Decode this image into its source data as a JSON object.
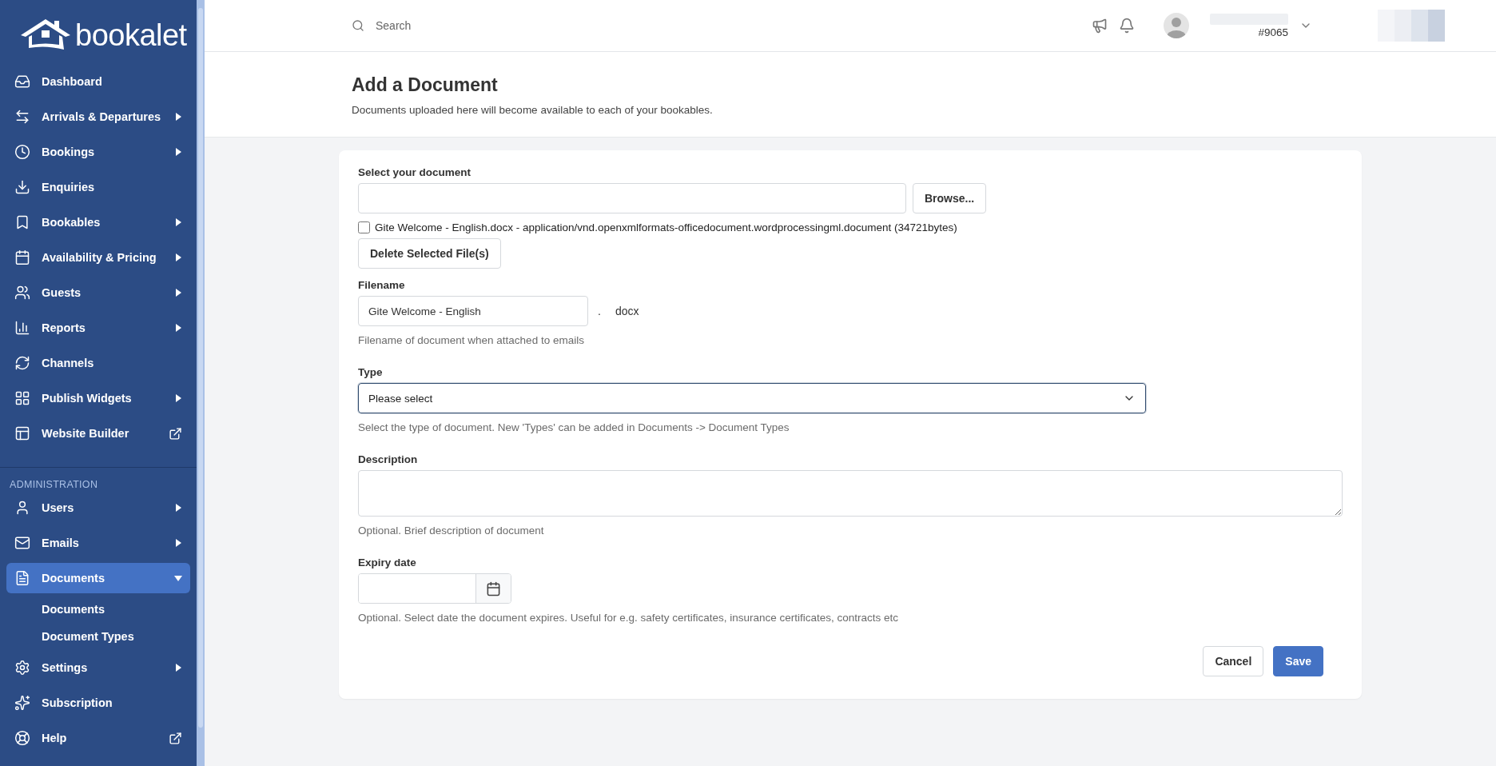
{
  "sidebar": {
    "logo": "bookalet",
    "items": [
      {
        "label": "Dashboard",
        "kind": "link",
        "selected": false
      },
      {
        "label": "Arrivals & Departures",
        "kind": "submenu",
        "expanded": false,
        "selected": false
      },
      {
        "label": "Bookings",
        "kind": "submenu",
        "expanded": false,
        "selected": false
      },
      {
        "label": "Enquiries",
        "kind": "link",
        "selected": false
      },
      {
        "label": "Bookables",
        "kind": "submenu",
        "expanded": false,
        "selected": false
      },
      {
        "label": "Availability & Pricing",
        "kind": "submenu",
        "expanded": false,
        "selected": false
      },
      {
        "label": "Guests",
        "kind": "submenu",
        "expanded": false,
        "selected": false
      },
      {
        "label": "Reports",
        "kind": "submenu",
        "expanded": false,
        "selected": false
      },
      {
        "label": "Channels",
        "kind": "link",
        "selected": false
      },
      {
        "label": "Publish Widgets",
        "kind": "submenu",
        "expanded": false,
        "selected": false
      },
      {
        "label": "Website Builder",
        "kind": "external",
        "selected": false
      }
    ],
    "section_heading": "ADMINISTRATION",
    "admin_items": [
      {
        "label": "Users",
        "kind": "submenu",
        "expanded": false,
        "selected": false
      },
      {
        "label": "Emails",
        "kind": "submenu",
        "expanded": false,
        "selected": false
      },
      {
        "label": "Documents",
        "kind": "submenu",
        "expanded": true,
        "selected": true,
        "children": [
          {
            "label": "Documents"
          },
          {
            "label": "Document Types"
          }
        ]
      },
      {
        "label": "Settings",
        "kind": "submenu",
        "expanded": false,
        "selected": false
      },
      {
        "label": "Subscription",
        "kind": "link",
        "selected": false
      },
      {
        "label": "Help",
        "kind": "external",
        "selected": false
      }
    ]
  },
  "topbar": {
    "search": {
      "placeholder": "Search"
    },
    "account_number": "#9065"
  },
  "page": {
    "title": "Add a Document",
    "subtitle": "Documents uploaded here will become available to each of your bookables."
  },
  "form": {
    "file": {
      "label": "Select your document",
      "button": "Browse..."
    },
    "attached_file": {
      "checked": false,
      "text": "Gite Welcome - English.docx - application/vnd.openxmlformats-officedocument.wordprocessingml.document (34721bytes)"
    },
    "delete_button": "Delete Selected File(s)",
    "filename": {
      "label": "Filename",
      "value": "Gite Welcome - English",
      "separator": ".",
      "extension": "docx",
      "hint": "Filename of document when attached to emails"
    },
    "type": {
      "label": "Type",
      "value": "Please select",
      "focused": true,
      "hint": "Select the type of document. New 'Types' can be added in Documents -> Document Types"
    },
    "description": {
      "label": "Description",
      "hint": "Optional. Brief description of document"
    },
    "expiry": {
      "label": "Expiry date",
      "hint": "Optional. Select date the document expires. Useful for e.g. safety certificates, insurance certificates, contracts etc"
    },
    "buttons": [
      {
        "label": "Cancel",
        "kind": "secondary"
      },
      {
        "label": "Save",
        "kind": "primary"
      }
    ]
  }
}
